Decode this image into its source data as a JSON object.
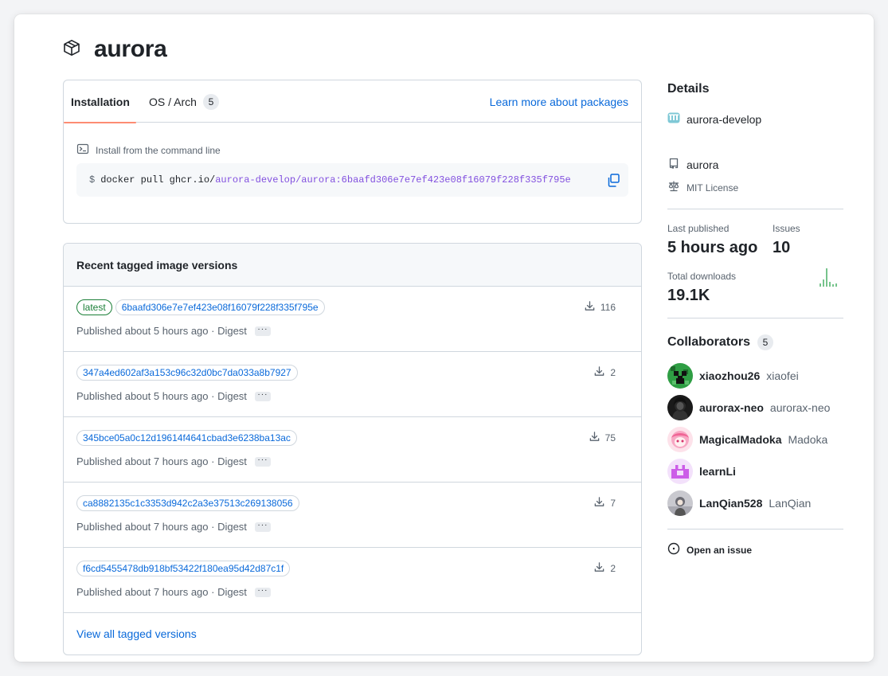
{
  "package": {
    "name": "aurora",
    "icon": "package-icon"
  },
  "tabs": {
    "installation": "Installation",
    "os_arch": "OS / Arch",
    "os_arch_count": "5",
    "learn_more": "Learn more about packages"
  },
  "install": {
    "label": "Install from the command line",
    "prompt": "$",
    "cmd_prefix": "docker pull ghcr.io/",
    "cmd_owner": "aurora-develop",
    "cmd_sep": "/",
    "cmd_image": "aurora:6baafd306e7e7ef423e08f16079f228f335f795e"
  },
  "versions": {
    "title": "Recent tagged image versions",
    "items": [
      {
        "tag": "latest",
        "digest": "6baafd306e7e7ef423e08f16079f228f335f795e",
        "published": "Published about 5 hours ago · Digest",
        "downloads": "116"
      },
      {
        "tag": "",
        "digest": "347a4ed602af3a153c96c32d0bc7da033a8b7927",
        "published": "Published about 5 hours ago · Digest",
        "downloads": "2"
      },
      {
        "tag": "",
        "digest": "345bce05a0c12d19614f4641cbad3e6238ba13ac",
        "published": "Published about 7 hours ago · Digest",
        "downloads": "75"
      },
      {
        "tag": "",
        "digest": "ca8882135c1c3353d942c2a3e37513c269138056",
        "published": "Published about 7 hours ago · Digest",
        "downloads": "7"
      },
      {
        "tag": "",
        "digest": "f6cd5455478db918bf53422f180ea95d42d87c1f",
        "published": "Published about 7 hours ago · Digest",
        "downloads": "2"
      }
    ],
    "more_label": "···",
    "view_all": "View all tagged versions"
  },
  "details": {
    "title": "Details",
    "org": "aurora-develop",
    "repo": "aurora",
    "license": "MIT License",
    "last_published_label": "Last published",
    "last_published": "5 hours ago",
    "issues_label": "Issues",
    "issues": "10",
    "downloads_label": "Total downloads",
    "downloads": "19.1K"
  },
  "collaborators": {
    "title": "Collaborators",
    "count": "5",
    "people": [
      {
        "login": "xiaozhou26",
        "name": "xiaofei"
      },
      {
        "login": "aurorax-neo",
        "name": "aurorax-neo"
      },
      {
        "login": "MagicalMadoka",
        "name": "Madoka"
      },
      {
        "login": "learnLi",
        "name": ""
      },
      {
        "login": "LanQian528",
        "name": "LanQian"
      }
    ]
  },
  "open_issue": "Open an issue",
  "colors": {
    "link": "#0969da",
    "purple": "#8250df",
    "green": "#1a7f37",
    "tab_accent": "#fd8c73",
    "border": "#d0d7de"
  }
}
